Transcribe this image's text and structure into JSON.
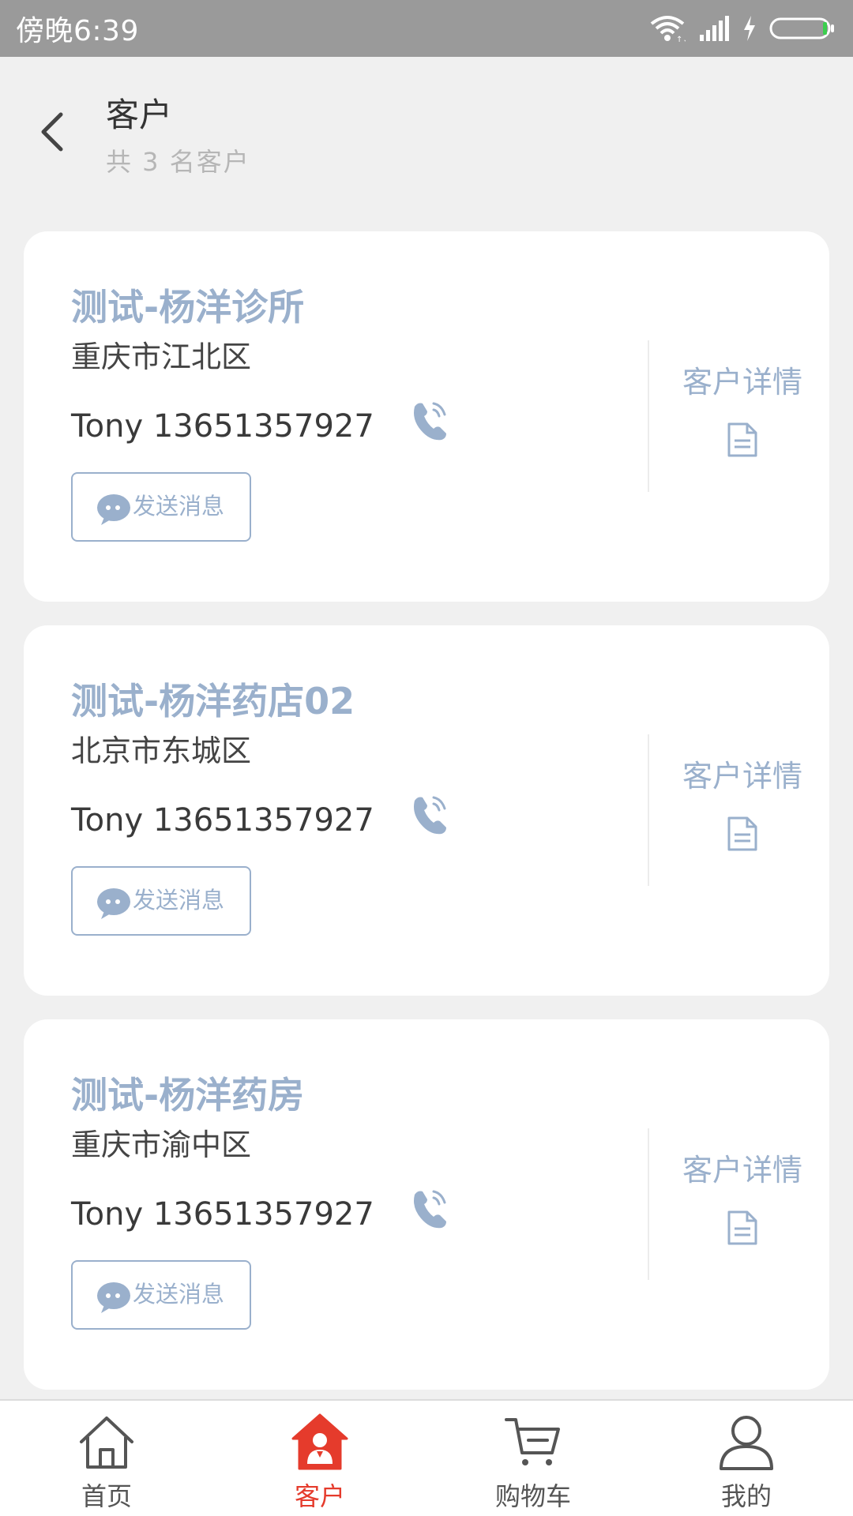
{
  "status_bar": {
    "time": "傍晚6:39"
  },
  "header": {
    "title": "客户",
    "subtitle": "共 3 名客户"
  },
  "customers": [
    {
      "name": "测试-杨洋诊所",
      "region": "重庆市江北区",
      "contact": "Tony 13651357927",
      "send_label": "发送消息",
      "detail_label": "客户详情"
    },
    {
      "name": "测试-杨洋药店02",
      "region": "北京市东城区",
      "contact": "Tony 13651357927",
      "send_label": "发送消息",
      "detail_label": "客户详情"
    },
    {
      "name": "测试-杨洋药房",
      "region": "重庆市渝中区",
      "contact": "Tony 13651357927",
      "send_label": "发送消息",
      "detail_label": "客户详情"
    }
  ],
  "nav": [
    {
      "label": "首页",
      "icon": "home-icon",
      "active": false
    },
    {
      "label": "客户",
      "icon": "customer-icon",
      "active": true
    },
    {
      "label": "购物车",
      "icon": "cart-icon",
      "active": false
    },
    {
      "label": "我的",
      "icon": "profile-icon",
      "active": false
    }
  ],
  "colors": {
    "accent": "#9ab0cc",
    "active_nav": "#e53b2c",
    "status_bar": "#9a9a9a",
    "background": "#f0f0f0"
  }
}
